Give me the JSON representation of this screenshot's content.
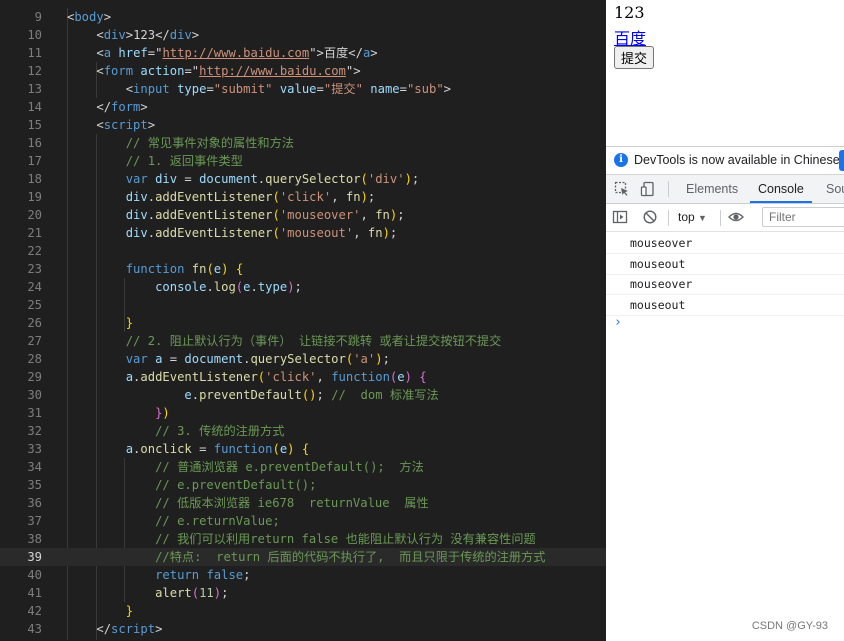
{
  "editor": {
    "active_line": "39",
    "lines": [
      {
        "n": "9",
        "t": [
          [
            "pun",
            "<"
          ],
          [
            "tag",
            "body"
          ],
          [
            "pun",
            ">"
          ]
        ]
      },
      {
        "n": "10",
        "t": [
          [
            "txt",
            "    "
          ],
          [
            "pun",
            "<"
          ],
          [
            "tag",
            "div"
          ],
          [
            "pun",
            ">"
          ],
          [
            "txt",
            "123"
          ],
          [
            "pun",
            "</"
          ],
          [
            "tag",
            "div"
          ],
          [
            "pun",
            ">"
          ]
        ]
      },
      {
        "n": "11",
        "t": [
          [
            "txt",
            "    "
          ],
          [
            "pun",
            "<"
          ],
          [
            "tag",
            "a"
          ],
          [
            "txt",
            " "
          ],
          [
            "attr",
            "href"
          ],
          [
            "pun",
            "=\""
          ],
          [
            "link",
            "http://www.baidu.com"
          ],
          [
            "pun",
            "\">"
          ],
          [
            "txt",
            "百度"
          ],
          [
            "pun",
            "</"
          ],
          [
            "tag",
            "a"
          ],
          [
            "pun",
            ">"
          ]
        ]
      },
      {
        "n": "12",
        "t": [
          [
            "txt",
            "    "
          ],
          [
            "pun",
            "<"
          ],
          [
            "tag",
            "form"
          ],
          [
            "txt",
            " "
          ],
          [
            "attr",
            "action"
          ],
          [
            "pun",
            "=\""
          ],
          [
            "link",
            "http://www.baidu.com"
          ],
          [
            "pun",
            "\">"
          ]
        ]
      },
      {
        "n": "13",
        "t": [
          [
            "txt",
            "        "
          ],
          [
            "pun",
            "<"
          ],
          [
            "tag",
            "input"
          ],
          [
            "txt",
            " "
          ],
          [
            "attr",
            "type"
          ],
          [
            "pun",
            "="
          ],
          [
            "str",
            "\"submit\""
          ],
          [
            "txt",
            " "
          ],
          [
            "attr",
            "value"
          ],
          [
            "pun",
            "="
          ],
          [
            "str",
            "\"提交\""
          ],
          [
            "txt",
            " "
          ],
          [
            "attr",
            "name"
          ],
          [
            "pun",
            "="
          ],
          [
            "str",
            "\"sub\""
          ],
          [
            "pun",
            ">"
          ]
        ]
      },
      {
        "n": "14",
        "t": [
          [
            "txt",
            "    "
          ],
          [
            "pun",
            "</"
          ],
          [
            "tag",
            "form"
          ],
          [
            "pun",
            ">"
          ]
        ]
      },
      {
        "n": "15",
        "t": [
          [
            "txt",
            "    "
          ],
          [
            "pun",
            "<"
          ],
          [
            "tag",
            "script"
          ],
          [
            "pun",
            ">"
          ]
        ]
      },
      {
        "n": "16",
        "t": [
          [
            "txt",
            "        "
          ],
          [
            "cm",
            "// 常见事件对象的属性和方法"
          ]
        ]
      },
      {
        "n": "17",
        "t": [
          [
            "txt",
            "        "
          ],
          [
            "cm",
            "// 1. 返回事件类型"
          ]
        ]
      },
      {
        "n": "18",
        "t": [
          [
            "txt",
            "        "
          ],
          [
            "kw",
            "var"
          ],
          [
            "txt",
            " "
          ],
          [
            "var",
            "div"
          ],
          [
            "txt",
            " = "
          ],
          [
            "var",
            "document"
          ],
          [
            "txt",
            "."
          ],
          [
            "fn",
            "querySelector"
          ],
          [
            "br",
            "("
          ],
          [
            "str",
            "'div'"
          ],
          [
            "br",
            ")"
          ],
          [
            "txt",
            ";"
          ]
        ]
      },
      {
        "n": "19",
        "t": [
          [
            "txt",
            "        "
          ],
          [
            "var",
            "div"
          ],
          [
            "txt",
            "."
          ],
          [
            "fn",
            "addEventListener"
          ],
          [
            "br",
            "("
          ],
          [
            "str",
            "'click'"
          ],
          [
            "txt",
            ", "
          ],
          [
            "fn",
            "fn"
          ],
          [
            "br",
            ")"
          ],
          [
            "txt",
            ";"
          ]
        ]
      },
      {
        "n": "20",
        "t": [
          [
            "txt",
            "        "
          ],
          [
            "var",
            "div"
          ],
          [
            "txt",
            "."
          ],
          [
            "fn",
            "addEventListener"
          ],
          [
            "br",
            "("
          ],
          [
            "str",
            "'mouseover'"
          ],
          [
            "txt",
            ", "
          ],
          [
            "fn",
            "fn"
          ],
          [
            "br",
            ")"
          ],
          [
            "txt",
            ";"
          ]
        ]
      },
      {
        "n": "21",
        "t": [
          [
            "txt",
            "        "
          ],
          [
            "var",
            "div"
          ],
          [
            "txt",
            "."
          ],
          [
            "fn",
            "addEventListener"
          ],
          [
            "br",
            "("
          ],
          [
            "str",
            "'mouseout'"
          ],
          [
            "txt",
            ", "
          ],
          [
            "fn",
            "fn"
          ],
          [
            "br",
            ")"
          ],
          [
            "txt",
            ";"
          ]
        ]
      },
      {
        "n": "22",
        "t": []
      },
      {
        "n": "23",
        "t": [
          [
            "txt",
            "        "
          ],
          [
            "kw",
            "function"
          ],
          [
            "txt",
            " "
          ],
          [
            "fn",
            "fn"
          ],
          [
            "br",
            "("
          ],
          [
            "var",
            "e"
          ],
          [
            "br",
            ")"
          ],
          [
            "txt",
            " "
          ],
          [
            "br",
            "{"
          ]
        ]
      },
      {
        "n": "24",
        "t": [
          [
            "txt",
            "            "
          ],
          [
            "var",
            "console"
          ],
          [
            "txt",
            "."
          ],
          [
            "fn",
            "log"
          ],
          [
            "br2",
            "("
          ],
          [
            "var",
            "e"
          ],
          [
            "txt",
            "."
          ],
          [
            "var",
            "type"
          ],
          [
            "br2",
            ")"
          ],
          [
            "txt",
            ";"
          ]
        ]
      },
      {
        "n": "25",
        "t": []
      },
      {
        "n": "26",
        "t": [
          [
            "txt",
            "        "
          ],
          [
            "br",
            "}"
          ]
        ]
      },
      {
        "n": "27",
        "t": [
          [
            "txt",
            "        "
          ],
          [
            "cm",
            "// 2. 阻止默认行为（事件） 让链接不跳转 或者让提交按钮不提交"
          ]
        ]
      },
      {
        "n": "28",
        "t": [
          [
            "txt",
            "        "
          ],
          [
            "kw",
            "var"
          ],
          [
            "txt",
            " "
          ],
          [
            "var",
            "a"
          ],
          [
            "txt",
            " = "
          ],
          [
            "var",
            "document"
          ],
          [
            "txt",
            "."
          ],
          [
            "fn",
            "querySelector"
          ],
          [
            "br",
            "("
          ],
          [
            "str",
            "'a'"
          ],
          [
            "br",
            ")"
          ],
          [
            "txt",
            ";"
          ]
        ]
      },
      {
        "n": "29",
        "t": [
          [
            "txt",
            "        "
          ],
          [
            "var",
            "a"
          ],
          [
            "txt",
            "."
          ],
          [
            "fn",
            "addEventListener"
          ],
          [
            "br",
            "("
          ],
          [
            "str",
            "'click'"
          ],
          [
            "txt",
            ", "
          ],
          [
            "kw",
            "function"
          ],
          [
            "br2",
            "("
          ],
          [
            "var",
            "e"
          ],
          [
            "br2",
            ")"
          ],
          [
            "txt",
            " "
          ],
          [
            "br2",
            "{"
          ]
        ]
      },
      {
        "n": "30",
        "t": [
          [
            "txt",
            "                "
          ],
          [
            "var",
            "e"
          ],
          [
            "txt",
            "."
          ],
          [
            "fn",
            "preventDefault"
          ],
          [
            "br",
            "()"
          ],
          [
            "txt",
            "; "
          ],
          [
            "cm",
            "//  dom 标准写法"
          ]
        ]
      },
      {
        "n": "31",
        "t": [
          [
            "txt",
            "            "
          ],
          [
            "br2",
            "}"
          ],
          [
            "br",
            ")"
          ]
        ]
      },
      {
        "n": "32",
        "t": [
          [
            "txt",
            "            "
          ],
          [
            "cm",
            "// 3. 传统的注册方式"
          ]
        ]
      },
      {
        "n": "33",
        "t": [
          [
            "txt",
            "        "
          ],
          [
            "var",
            "a"
          ],
          [
            "txt",
            "."
          ],
          [
            "fn",
            "onclick"
          ],
          [
            "txt",
            " = "
          ],
          [
            "kw",
            "function"
          ],
          [
            "br",
            "("
          ],
          [
            "var",
            "e"
          ],
          [
            "br",
            ")"
          ],
          [
            "txt",
            " "
          ],
          [
            "br",
            "{"
          ]
        ]
      },
      {
        "n": "34",
        "t": [
          [
            "txt",
            "            "
          ],
          [
            "cm",
            "// 普通浏览器 e.preventDefault();  方法"
          ]
        ]
      },
      {
        "n": "35",
        "t": [
          [
            "txt",
            "            "
          ],
          [
            "cm",
            "// e.preventDefault();"
          ]
        ]
      },
      {
        "n": "36",
        "t": [
          [
            "txt",
            "            "
          ],
          [
            "cm",
            "// 低版本浏览器 ie678  returnValue  属性"
          ]
        ]
      },
      {
        "n": "37",
        "t": [
          [
            "txt",
            "            "
          ],
          [
            "cm",
            "// e.returnValue;"
          ]
        ]
      },
      {
        "n": "38",
        "t": [
          [
            "txt",
            "            "
          ],
          [
            "cm",
            "// 我们可以利用return false 也能阻止默认行为 没有兼容性问题"
          ]
        ]
      },
      {
        "n": "39",
        "t": [
          [
            "txt",
            "            "
          ],
          [
            "cm",
            "//特点:  return 后面的代码不执行了,  而且只限于传统的注册方式"
          ]
        ]
      },
      {
        "n": "40",
        "t": [
          [
            "txt",
            "            "
          ],
          [
            "kw",
            "return"
          ],
          [
            "txt",
            " "
          ],
          [
            "kw",
            "false"
          ],
          [
            "txt",
            ";"
          ]
        ]
      },
      {
        "n": "41",
        "t": [
          [
            "txt",
            "            "
          ],
          [
            "fn",
            "alert"
          ],
          [
            "br2",
            "("
          ],
          [
            "num",
            "11"
          ],
          [
            "br2",
            ")"
          ],
          [
            "txt",
            ";"
          ]
        ]
      },
      {
        "n": "42",
        "t": [
          [
            "txt",
            "        "
          ],
          [
            "br",
            "}"
          ]
        ]
      },
      {
        "n": "43",
        "t": [
          [
            "txt",
            "    "
          ],
          [
            "pun",
            "</"
          ],
          [
            "tag",
            "script"
          ],
          [
            "pun",
            ">"
          ]
        ]
      }
    ]
  },
  "page": {
    "div_text": "123",
    "link_text": "百度",
    "submit_value": "提交"
  },
  "devtools": {
    "info_message": "DevTools is now available in Chinese!",
    "tabs": [
      {
        "label": "Elements",
        "active": false
      },
      {
        "label": "Console",
        "active": true
      },
      {
        "label": "Sou",
        "active": false
      }
    ],
    "context": "top",
    "filter_placeholder": "Filter",
    "logs": [
      "mouseover",
      "mouseout",
      "mouseover",
      "mouseout"
    ],
    "prompt_symbol": "›"
  },
  "watermark": "CSDN @GY-93",
  "colors": {
    "accent": "#1a73e8",
    "editor_bg": "#1f1f1f"
  }
}
